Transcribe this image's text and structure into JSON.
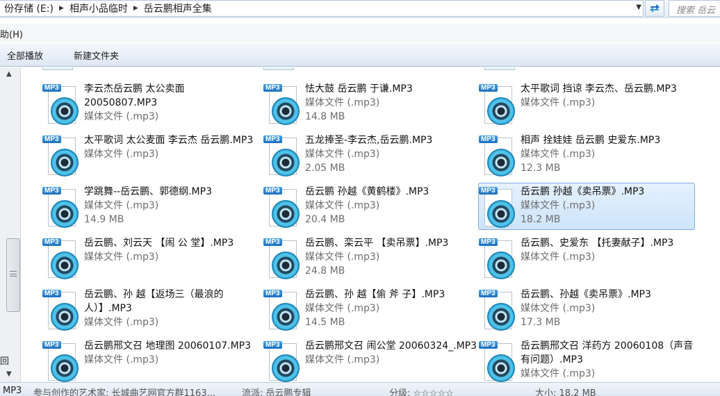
{
  "address_bar": {
    "crumbs": [
      "份存储 (E:)",
      "相声小品临时",
      "岳云鹏相声全集"
    ],
    "search_placeholder": "搜索 岳云"
  },
  "menu": {
    "help": "助(H)"
  },
  "toolbar": {
    "play_all": "全部播放",
    "new_folder": "新建文件夹"
  },
  "left_edge_label": "回",
  "files": [
    {
      "name": "李云杰岳云鹏 太公卖面 20050807.MP3",
      "type": "媒体文件 (.mp3)",
      "size": "",
      "selected": false
    },
    {
      "name": "怯大鼓 岳云鹏 于谦.MP3",
      "type": "媒体文件 (.mp3)",
      "size": "14.8 MB",
      "selected": false
    },
    {
      "name": "太平歌词 挡谅 李云杰、岳云鹏.MP3",
      "type": "媒体文件 (.mp3)",
      "size": "",
      "selected": false
    },
    {
      "name": "太平歌词 太公麦面 李云杰 岳云鹏.MP3",
      "type": "媒体文件 (.mp3)",
      "size": "",
      "selected": false
    },
    {
      "name": "五龙捧圣-李云杰,岳云鹏.MP3",
      "type": "媒体文件 (.mp3)",
      "size": "2.05 MB",
      "selected": false
    },
    {
      "name": "相声 拴娃娃 岳云鹏 史爱东.MP3",
      "type": "媒体文件 (.mp3)",
      "size": "12.3 MB",
      "selected": false
    },
    {
      "name": "学跳舞--岳云鹏、郭德纲.MP3",
      "type": "媒体文件 (.mp3)",
      "size": "14.9 MB",
      "selected": false
    },
    {
      "name": "岳云鹏 孙越《黄鹤楼》.MP3",
      "type": "媒体文件 (.mp3)",
      "size": "20.4 MB",
      "selected": false
    },
    {
      "name": "岳云鹏 孙越《卖吊票》.MP3",
      "type": "媒体文件 (.mp3)",
      "size": "18.2 MB",
      "selected": true
    },
    {
      "name": "岳云鹏、刘云天 【闹 公 堂】.MP3",
      "type": "媒体文件 (.mp3)",
      "size": "",
      "selected": false
    },
    {
      "name": "岳云鹏、栾云平 【卖吊票】.MP3",
      "type": "媒体文件 (.mp3)",
      "size": "24.8 MB",
      "selected": false
    },
    {
      "name": "岳云鹏、史爱东 【托妻献子】.MP3",
      "type": "媒体文件 (.mp3)",
      "size": "",
      "selected": false
    },
    {
      "name": "岳云鹏、孙 越【返场三（最浪的人）】.MP3",
      "type": "媒体文件 (.mp3)",
      "size": "",
      "selected": false
    },
    {
      "name": "岳云鹏、孙 越【偷 斧 子】.MP3",
      "type": "媒体文件 (.mp3)",
      "size": "14.5 MB",
      "selected": false
    },
    {
      "name": "岳云鹏、孙越《卖吊票》.MP3",
      "type": "媒体文件 (.mp3)",
      "size": "17.3 MB",
      "selected": false
    },
    {
      "name": "岳云鹏邢文召 地理图 20060107.MP3",
      "type": "媒体文件 (.mp3)",
      "size": "",
      "selected": false
    },
    {
      "name": "岳云鹏邢文召 闹公堂 20060324_.MP3",
      "type": "媒体文件 (.mp3)",
      "size": "",
      "selected": false
    },
    {
      "name": "岳云鹏邢文召 洋药方 20060108（声音有问题）.MP3",
      "type": "媒体文件 (.mp3)",
      "size": "",
      "selected": false
    }
  ],
  "statusbar": {
    "type": "MP3",
    "artist": "参与创作的艺术家: 长城曲艺网官方群1163...",
    "genre": "流派: 岳云鹏专辑",
    "rating": "分级: ☆☆☆☆☆",
    "size": "大小: 18.2 MB"
  }
}
